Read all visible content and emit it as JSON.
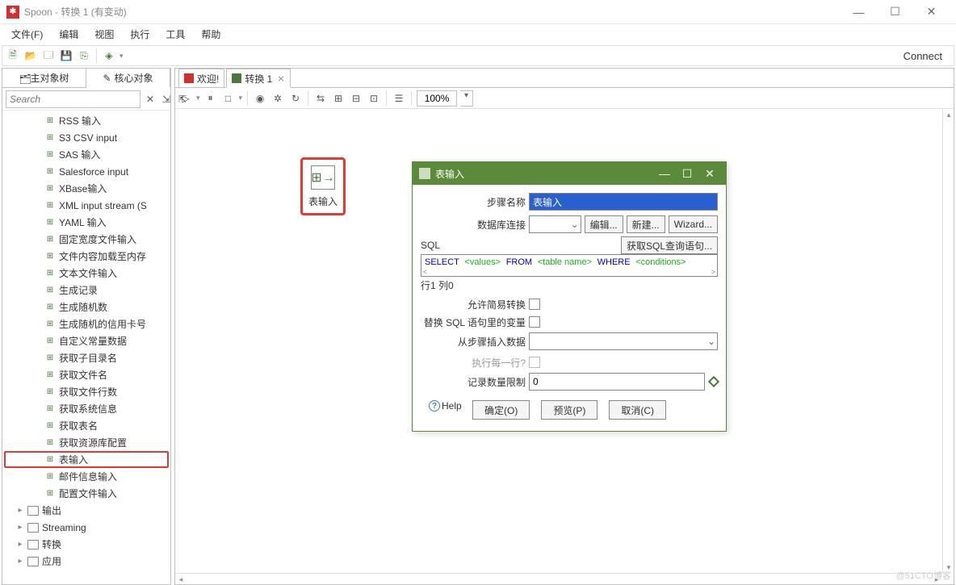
{
  "window": {
    "title": "Spoon - 转换 1 (有变动)"
  },
  "menu": {
    "file": "文件(F)",
    "edit": "编辑",
    "view": "视图",
    "run": "执行",
    "tools": "工具",
    "help": "帮助"
  },
  "toolbar": {
    "connect": "Connect"
  },
  "left_tabs": {
    "main": "主对象树",
    "core": "核心对象"
  },
  "search": {
    "placeholder": "Search"
  },
  "tree": {
    "input_items": [
      "RSS 输入",
      "S3 CSV input",
      "SAS 输入",
      "Salesforce input",
      "XBase输入",
      "XML input stream (S",
      "YAML 输入",
      "固定宽度文件输入",
      "文件内容加载至内存",
      "文本文件输入",
      "生成记录",
      "生成随机数",
      "生成随机的信用卡号",
      "自定义常量数据",
      "获取子目录名",
      "获取文件名",
      "获取文件行数",
      "获取系统信息",
      "获取表名",
      "获取资源库配置",
      "表输入",
      "邮件信息输入",
      "配置文件输入"
    ],
    "folders": [
      "输出",
      "Streaming",
      "转换",
      "应用"
    ]
  },
  "canvas_tabs": {
    "welcome": "欢迎!",
    "trans": "转换 1"
  },
  "canvas": {
    "zoom": "100%",
    "step_label": "表输入"
  },
  "dialog": {
    "title": "表输入",
    "labels": {
      "step_name": "步骤名称",
      "db_conn": "数据库连接",
      "edit": "编辑...",
      "new": "新建...",
      "wizard": "Wizard...",
      "sql": "SQL",
      "get_sql": "获取SQL查询语句...",
      "row_status": "行1 列0",
      "allow_lazy": "允许简易转换",
      "replace_vars": "替换 SQL 语句里的变量",
      "insert_from": "从步骤插入数据",
      "each_row": "执行每一行?",
      "limit": "记录数量限制"
    },
    "values": {
      "step_name": "表输入",
      "limit": "0"
    },
    "sql": {
      "select": "SELECT",
      "values": "<values>",
      "from": "FROM",
      "table": "<table name>",
      "where": "WHERE",
      "cond": "<conditions>"
    },
    "buttons": {
      "help": "Help",
      "ok": "确定(O)",
      "preview": "预览(P)",
      "cancel": "取消(C)"
    }
  },
  "watermark": "@51CTO博客"
}
